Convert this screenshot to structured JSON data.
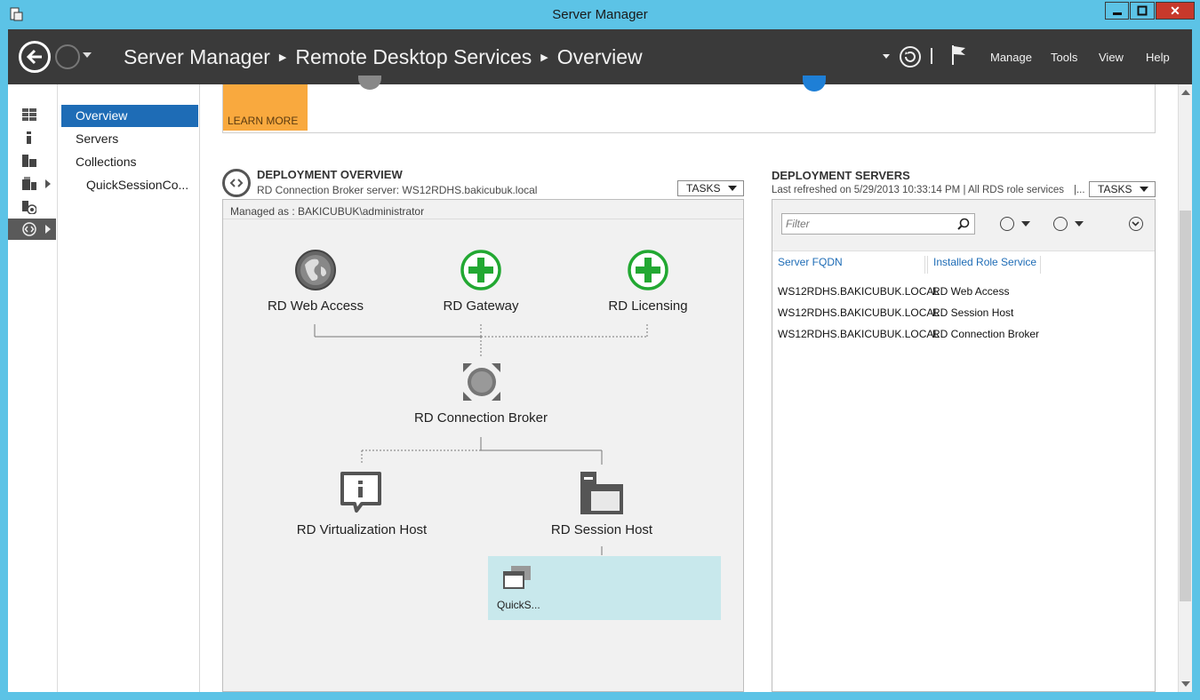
{
  "window": {
    "title": "Server Manager"
  },
  "header": {
    "breadcrumb": [
      "Server Manager",
      "Remote Desktop Services",
      "Overview"
    ],
    "menus": [
      "Manage",
      "Tools",
      "View",
      "Help"
    ]
  },
  "nav": {
    "items": [
      "Overview",
      "Servers",
      "Collections",
      "QuickSessionCo..."
    ]
  },
  "banner": {
    "learn_more": "LEARN MORE"
  },
  "deployment_overview": {
    "title": "DEPLOYMENT OVERVIEW",
    "subtitle": "RD Connection Broker server: WS12RDHS.bakicubuk.local",
    "tasks": "TASKS",
    "managed_as": "Managed as : BAKICUBUK\\administrator",
    "nodes": {
      "web_access": "RD Web Access",
      "gateway": "RD Gateway",
      "licensing": "RD Licensing",
      "connection_broker": "RD Connection Broker",
      "virtualization_host": "RD Virtualization Host",
      "session_host": "RD Session Host"
    },
    "collection_label": "QuickS..."
  },
  "deployment_servers": {
    "title": "DEPLOYMENT SERVERS",
    "subtitle": "Last refreshed on 5/29/2013 10:33:14 PM | All RDS role services",
    "subtitle_more": "|...",
    "tasks": "TASKS",
    "filter_placeholder": "Filter",
    "columns": [
      "Server FQDN",
      "Installed Role Service"
    ],
    "rows": [
      [
        "WS12RDHS.BAKICUBUK.LOCAL",
        "RD Web Access"
      ],
      [
        "WS12RDHS.BAKICUBUK.LOCAL",
        "RD Session Host"
      ],
      [
        "WS12RDHS.BAKICUBUK.LOCAL",
        "RD Connection Broker"
      ]
    ]
  },
  "colors": {
    "title_bar": "#5cc3e6",
    "header_bg": "#3a3a3a",
    "nav_active": "#1e6cb6",
    "learn_more": "#f9a93e",
    "plus_green": "#22a832",
    "collection_bg": "#c8e8ec",
    "close_red": "#c7392b"
  }
}
